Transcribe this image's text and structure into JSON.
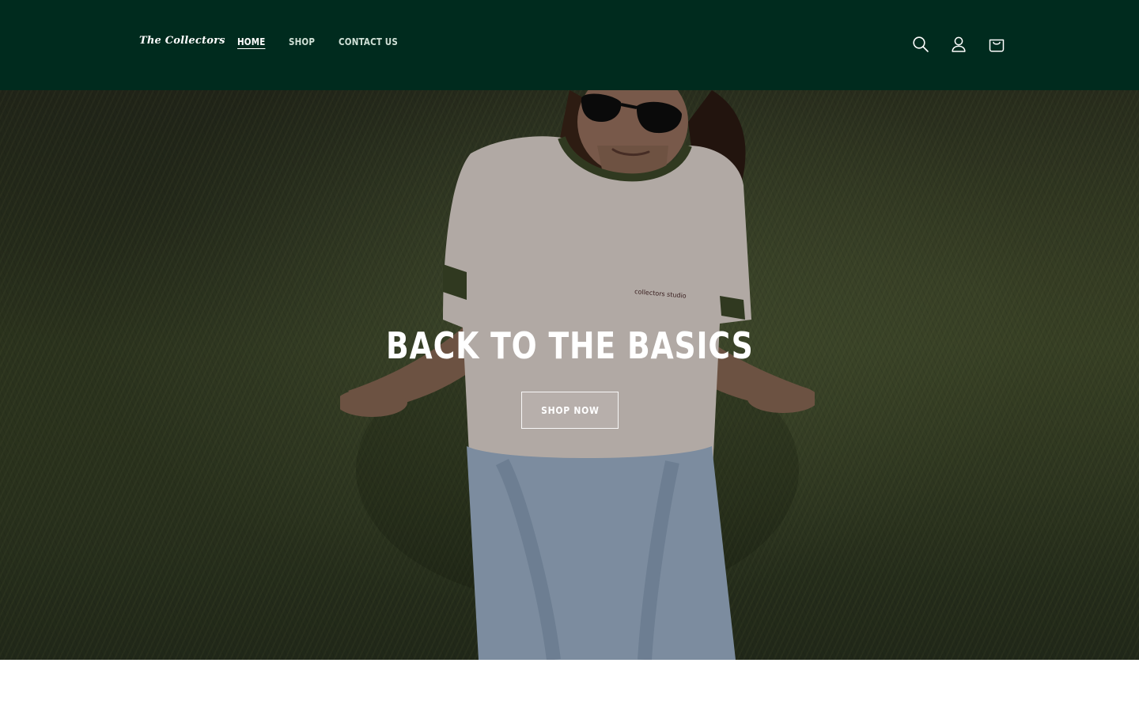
{
  "header": {
    "logo_text": "The Collectors",
    "nav": [
      {
        "label": "HOME",
        "active": true
      },
      {
        "label": "SHOP",
        "active": false
      },
      {
        "label": "CONTACT US",
        "active": false
      }
    ],
    "icons": [
      "search-icon",
      "account-icon",
      "cart-icon"
    ],
    "background_color": "#002b1e"
  },
  "hero": {
    "title": "BACK TO THE BASICS",
    "button_label": "SHOP NOW",
    "shirt_text": "collectors studio"
  }
}
